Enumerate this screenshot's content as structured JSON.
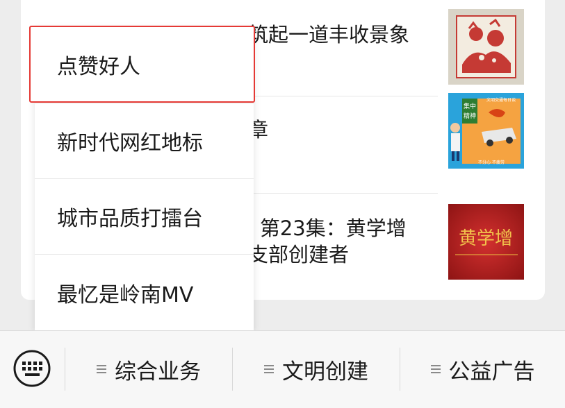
{
  "articles": [
    {
      "title": "筑起一道丰收景象",
      "thumb": "paper-cut-art-thumbnail"
    },
    {
      "title": "章",
      "thumb": "traffic-safety-poster-thumbnail",
      "thumb_header": "文明交通每日谈",
      "thumb_badge": "集中精神",
      "thumb_footer": "不分心  不疲劳"
    },
    {
      "title": "› 第23集：黄学增",
      "title2": "支部创建者",
      "thumb": "red-calligraphy-thumbnail",
      "thumb_text": "黄学增"
    }
  ],
  "menu": {
    "items": [
      {
        "label": "点赞好人"
      },
      {
        "label": "新时代网红地标"
      },
      {
        "label": "城市品质打擂台"
      },
      {
        "label": "最忆是岭南MV"
      }
    ],
    "highlight_color": "#e53935"
  },
  "bottom_bar": {
    "keyboard_icon": "keyboard-icon",
    "tabs": [
      {
        "label": "综合业务"
      },
      {
        "label": "文明创建"
      },
      {
        "label": "公益广告"
      }
    ]
  }
}
